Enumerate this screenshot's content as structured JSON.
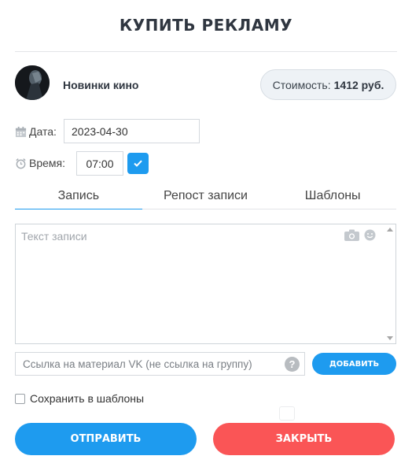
{
  "modal": {
    "title": "КУПИТЬ РЕКЛАМУ"
  },
  "group": {
    "name": "Новинки кино",
    "avatar_icon": "group-avatar"
  },
  "cost": {
    "label": "Стоимость:",
    "value": "1412 руб."
  },
  "schedule": {
    "date_label": "Дата:",
    "date_value": "2023-04-30",
    "time_label": "Время:",
    "time_value": "07:00",
    "date_icon": "calendar-icon",
    "time_icon": "alarm-clock-icon",
    "confirm_icon": "checkmark-icon"
  },
  "tabs": [
    {
      "label": "Запись",
      "active": true
    },
    {
      "label": "Репост записи",
      "active": false
    },
    {
      "label": "Шаблоны",
      "active": false
    }
  ],
  "post": {
    "placeholder": "Текст записи",
    "icons": [
      "camera-icon",
      "smiley-icon"
    ]
  },
  "link": {
    "placeholder": "Ссылка на материал VK (не ссылка на группу)",
    "help_glyph": "?",
    "add_label": "ДОБАВИТЬ"
  },
  "options": {
    "save_template_label": "Сохранить в шаблоны",
    "save_template_checked": false
  },
  "actions": {
    "send_label": "ОТПРАВИТЬ",
    "close_label": "ЗАКРЫТЬ"
  },
  "colors": {
    "accent": "#1e9bef",
    "danger": "#fa5556",
    "title": "#2f3640"
  }
}
